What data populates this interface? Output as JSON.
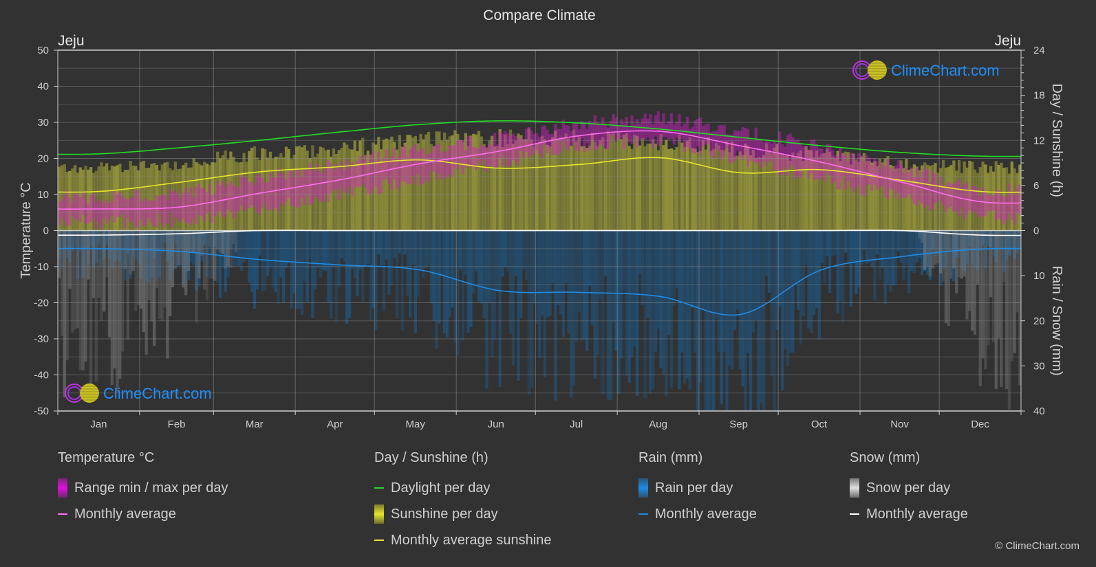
{
  "title": "Compare Climate",
  "location_left": "Jeju",
  "location_right": "Jeju",
  "watermark": "ClimeChart.com",
  "copyright": "© ClimeChart.com",
  "colors": {
    "background": "#323232",
    "temp_avg": "#ff6ef0",
    "temp_range": "#d21ec8",
    "daylight": "#22dd22",
    "sunshine_avg": "#e6e62a",
    "sunshine_bar": "#9a9a3a",
    "rain_avg": "#1e8ce6",
    "rain_bar": "#1c5a8c",
    "snow_avg": "#ffffff",
    "snow_bar": "#8a8a8a",
    "watermark": "#1e90ff"
  },
  "chart_data": {
    "type": "line",
    "title": "Compare Climate",
    "categories": [
      "Jan",
      "Feb",
      "Mar",
      "Apr",
      "May",
      "Jun",
      "Jul",
      "Aug",
      "Sep",
      "Oct",
      "Nov",
      "Dec"
    ],
    "left_axis": {
      "label": "Temperature °C",
      "range": [
        -50,
        50
      ],
      "ticks": [
        50,
        40,
        30,
        20,
        10,
        0,
        -10,
        -20,
        -30,
        -40,
        -50
      ]
    },
    "right_axis_top": {
      "label": "Day / Sunshine (h)",
      "range": [
        0,
        24
      ],
      "ticks": [
        24,
        18,
        12,
        6,
        0
      ]
    },
    "right_axis_bottom": {
      "label": "Rain / Snow (mm)",
      "range": [
        0,
        40
      ],
      "ticks": [
        0,
        10,
        20,
        30,
        40
      ]
    },
    "grid": true,
    "series": [
      {
        "name": "Temperature monthly average",
        "axis": "temperature",
        "unit": "°C",
        "values": [
          6.0,
          6.5,
          10.3,
          14.0,
          18.5,
          22.0,
          26.3,
          27.5,
          23.5,
          19.0,
          13.5,
          8.0
        ]
      },
      {
        "name": "Temperature range max per day",
        "axis": "temperature",
        "unit": "°C",
        "values": [
          9.5,
          10.5,
          14.5,
          18.5,
          22.5,
          25.5,
          29.5,
          31.0,
          27.5,
          23.0,
          17.5,
          11.5
        ]
      },
      {
        "name": "Temperature range min per day",
        "axis": "temperature",
        "unit": "°C",
        "values": [
          2.5,
          3.0,
          6.0,
          10.0,
          14.5,
          19.0,
          23.5,
          24.5,
          20.0,
          14.5,
          9.0,
          4.0
        ]
      },
      {
        "name": "Daylight per day",
        "axis": "hours",
        "unit": "h",
        "values": [
          10.2,
          11.0,
          12.0,
          13.1,
          14.1,
          14.6,
          14.3,
          13.5,
          12.4,
          11.3,
          10.4,
          9.9
        ]
      },
      {
        "name": "Monthly average sunshine",
        "axis": "hours",
        "unit": "h",
        "values": [
          5.2,
          6.4,
          7.8,
          8.5,
          9.4,
          8.3,
          8.8,
          9.7,
          7.7,
          8.1,
          6.7,
          5.2
        ]
      },
      {
        "name": "Sunshine per day (max)",
        "axis": "hours",
        "unit": "h",
        "values": [
          9.0,
          9.5,
          10.8,
          11.5,
          12.5,
          13.0,
          12.8,
          12.5,
          11.5,
          10.5,
          9.3,
          8.9
        ]
      },
      {
        "name": "Rain monthly average",
        "axis": "precip",
        "unit": "mm",
        "values": [
          4.0,
          4.6,
          6.4,
          7.6,
          8.7,
          13.3,
          13.7,
          14.6,
          18.6,
          8.8,
          5.8,
          4.1
        ]
      },
      {
        "name": "Snow monthly average",
        "axis": "precip",
        "unit": "mm",
        "values": [
          1.0,
          0.7,
          0.0,
          0.0,
          0.0,
          0.0,
          0.0,
          0.0,
          0.0,
          0.0,
          0.0,
          1.0
        ]
      }
    ]
  },
  "legend": {
    "groups": [
      {
        "title": "Temperature °C",
        "items": [
          {
            "kind": "bar",
            "label": "Range min / max per day",
            "color": "#e010e0"
          },
          {
            "kind": "line",
            "label": "Monthly average",
            "color": "#ff6ef0"
          }
        ]
      },
      {
        "title": "Day / Sunshine (h)",
        "items": [
          {
            "kind": "line",
            "label": "Daylight per day",
            "color": "#22dd22"
          },
          {
            "kind": "bar",
            "label": "Sunshine per day",
            "color": "#e6e62a"
          },
          {
            "kind": "line",
            "label": "Monthly average sunshine",
            "color": "#e6e62a"
          }
        ]
      },
      {
        "title": "Rain (mm)",
        "items": [
          {
            "kind": "bar",
            "label": "Rain per day",
            "color": "#1e8ce6"
          },
          {
            "kind": "line",
            "label": "Monthly average",
            "color": "#1e8ce6"
          }
        ]
      },
      {
        "title": "Snow (mm)",
        "items": [
          {
            "kind": "bar",
            "label": "Snow per day",
            "color": "#e0e0e0"
          },
          {
            "kind": "line",
            "label": "Monthly average",
            "color": "#ffffff"
          }
        ]
      }
    ]
  }
}
